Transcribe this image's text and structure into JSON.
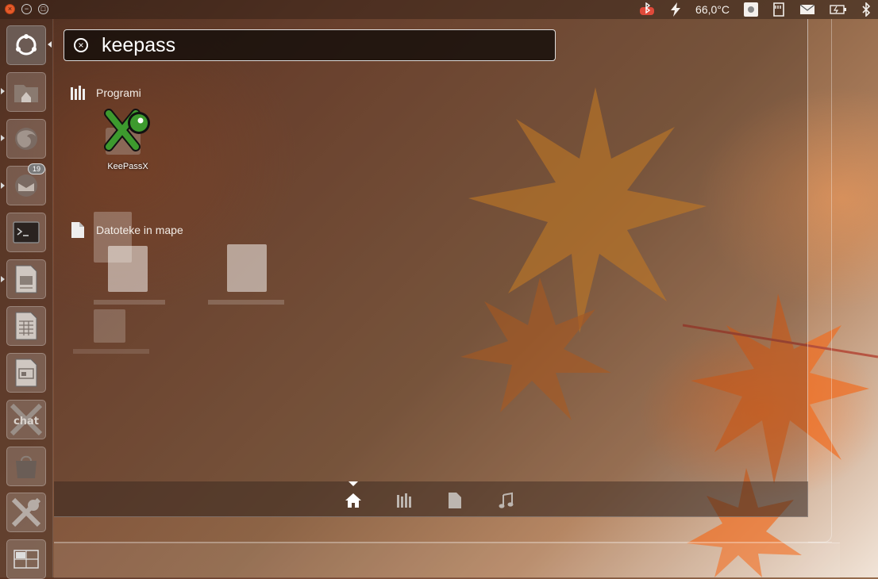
{
  "top_panel": {
    "window_controls": {
      "close": "×",
      "minimize": "−",
      "maximize": "□"
    },
    "indicators": {
      "temperature": "66,0°C"
    }
  },
  "launcher": {
    "items": [
      {
        "name": "dash-home",
        "icon": "ubuntu-logo-icon"
      },
      {
        "name": "home-folder",
        "icon": "home-folder-icon"
      },
      {
        "name": "firefox",
        "icon": "firefox-icon"
      },
      {
        "name": "thunderbird",
        "icon": "thunderbird-icon",
        "badge": "19"
      },
      {
        "name": "terminal",
        "icon": "terminal-icon"
      },
      {
        "name": "libreoffice-writer",
        "icon": "writer-icon"
      },
      {
        "name": "libreoffice-calc",
        "icon": "calc-icon"
      },
      {
        "name": "libreoffice-impress",
        "icon": "impress-icon"
      },
      {
        "name": "xchat",
        "icon": "xchat-icon",
        "text": "chat"
      },
      {
        "name": "software-center",
        "icon": "software-center-icon"
      },
      {
        "name": "keepassx",
        "icon": "keepassx-icon"
      },
      {
        "name": "workspace-switcher",
        "icon": "workspaces-icon"
      }
    ]
  },
  "search": {
    "query": "keepass"
  },
  "sections": {
    "applications": {
      "title": "Programi",
      "items": [
        {
          "label": "KeePassX"
        }
      ]
    },
    "files": {
      "title": "Datoteke in mape"
    }
  },
  "filters": [
    {
      "name": "home",
      "icon": "home-icon",
      "active": true
    },
    {
      "name": "applications",
      "icon": "applications-icon",
      "active": false
    },
    {
      "name": "files",
      "icon": "file-icon",
      "active": false
    },
    {
      "name": "music",
      "icon": "music-icon",
      "active": false
    }
  ],
  "colors": {
    "accent": "#e65b2a",
    "keepassx_green": "#2f9a2c"
  }
}
